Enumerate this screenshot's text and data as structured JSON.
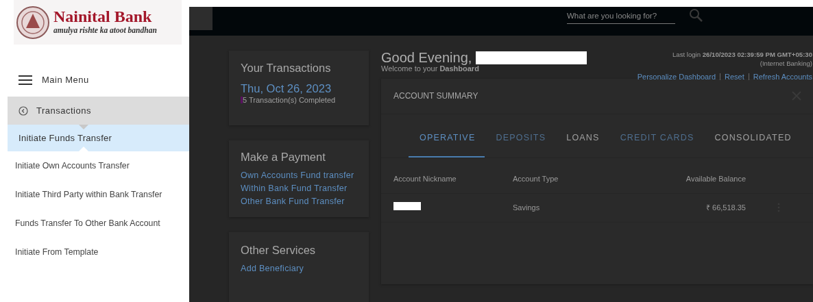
{
  "sidebar": {
    "logo": {
      "name": "Nainital Bank",
      "tagline": "amulya rishte ka atoot bandhan"
    },
    "main_menu": "Main Menu",
    "section": "Transactions",
    "items": [
      {
        "label": "Initiate Funds Transfer",
        "selected": true
      },
      {
        "label": "Initiate Own Accounts Transfer",
        "selected": false
      },
      {
        "label": "Initiate Third Party within Bank Transfer",
        "selected": false
      },
      {
        "label": "Funds Transfer To Other Bank Account",
        "selected": false
      },
      {
        "label": "Initiate From Template",
        "selected": false
      }
    ]
  },
  "header": {
    "search": {
      "placeholder": "What are you looking for?"
    }
  },
  "cards": [
    {
      "kind": "summary",
      "title": "Your Transactions",
      "date": "Thu, Oct 26, 2023",
      "note": "5 Transaction(s) Completed"
    },
    {
      "kind": "links",
      "title": "Make a Payment",
      "links": [
        "Own Accounts Fund transfer",
        "Within Bank Fund Transfer",
        "Other Bank Fund Transfer"
      ]
    },
    {
      "kind": "links",
      "title": "Other Services",
      "links": [
        "Add Beneficiary"
      ]
    }
  ],
  "greeting": {
    "text": "Good Evening,",
    "subtitle": "Welcome to your **Dashboard**"
  },
  "last_login": "Last login **26/10/2023 02:39:59 PM GMT+05:30**",
  "channel": "(Internet Banking)",
  "dashboard_links": [
    "Personalize Dashboard",
    "Reset",
    "Refresh Accounts"
  ],
  "account_summary": {
    "title": "ACCOUNT SUMMARY",
    "tabs": [
      {
        "label": "OPERATIVE",
        "selected": true,
        "disabled": false
      },
      {
        "label": "DEPOSITS",
        "selected": false,
        "disabled": true
      },
      {
        "label": "LOANS",
        "selected": false,
        "disabled": false
      },
      {
        "label": "CREDIT CARDS",
        "selected": false,
        "disabled": true
      },
      {
        "label": "CONSOLIDATED",
        "selected": false,
        "disabled": false
      }
    ],
    "columns": [
      "Account Nickname",
      "Account Type",
      "Available Balance"
    ],
    "rows": [
      {
        "type": "Savings",
        "balance": "₹ 66,518.35"
      }
    ]
  }
}
